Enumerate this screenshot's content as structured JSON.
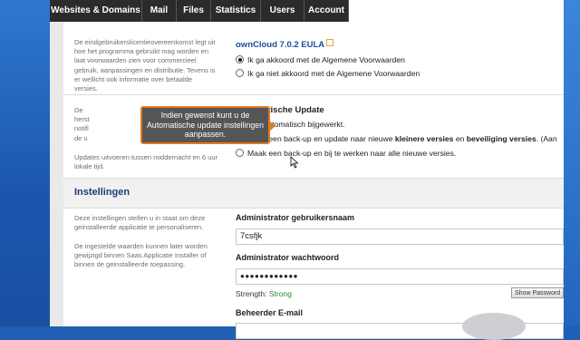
{
  "tabs": [
    {
      "label": "Websites & Domains"
    },
    {
      "label": "Mail"
    },
    {
      "label": "Files"
    },
    {
      "label": "Statistics"
    },
    {
      "label": "Users"
    },
    {
      "label": "Account"
    }
  ],
  "eula": {
    "left_text": "De eindgebruikerslicentieovereenkomst legt uit hoe het programma gebruikt mag worden en laat voorwaarden zien voor commercieel gebruik, aanpassingen en distributie. Tevens is er wellicht ook informatie over betaalde versies.",
    "title": "ownCloud 7.0.2 EULA",
    "options": [
      {
        "label": "Ik ga akkoord met de Algemene Voorwaarden",
        "checked": true
      },
      {
        "label": "Ik ga niet akkoord met de Algemene Voorwaarden",
        "checked": false
      }
    ]
  },
  "update": {
    "left_text_partial": "De herst notifi de u",
    "left_text_bottom": "Updates uitvoeren tussen middernacht en 6 uur lokale tijd.",
    "title": "Automatische Update",
    "opt1": "Niet automatisch bijgewerkt.",
    "opt2_prefix": "Maak een back-up en update naar nieuwe ",
    "opt2_bold1": "kleinere versies",
    "opt2_mid": " en ",
    "opt2_bold2": "beveiliging versies",
    "opt2_suffix": ". (Aan",
    "opt3": "Maak een back-up en bij te werken naar alle nieuwe versies.",
    "selected": 2
  },
  "tooltip": {
    "text": "Indien gewenst kunt u de Automatische update instellingen aanpassen."
  },
  "settings": {
    "title": "Instellingen",
    "left_text1": "Deze instellingen stellen u in staat om deze geinstalleerde applicatie te personaliseren.",
    "left_text2": "De ingestelde waarden kunnen later worden gewijzigd binnen Saas Applicatie Installer of binnen de geinstalleerde toepassing.",
    "admin_user_label": "Administrator gebruikersnaam",
    "admin_user_value": "7csfjk",
    "admin_pw_label": "Administrator wachtwoord",
    "admin_pw_value": "●●●●●●●●●●●●",
    "strength_label": "Strength:",
    "strength_value": "Strong",
    "show_pw_button": "Show Password",
    "email_label": "Beheerder E-mail"
  },
  "colors": {
    "accent": "#e07a1f",
    "title_blue": "#1b3d72",
    "link_blue": "#1b4f93",
    "strong_green": "#2a8a2a"
  }
}
